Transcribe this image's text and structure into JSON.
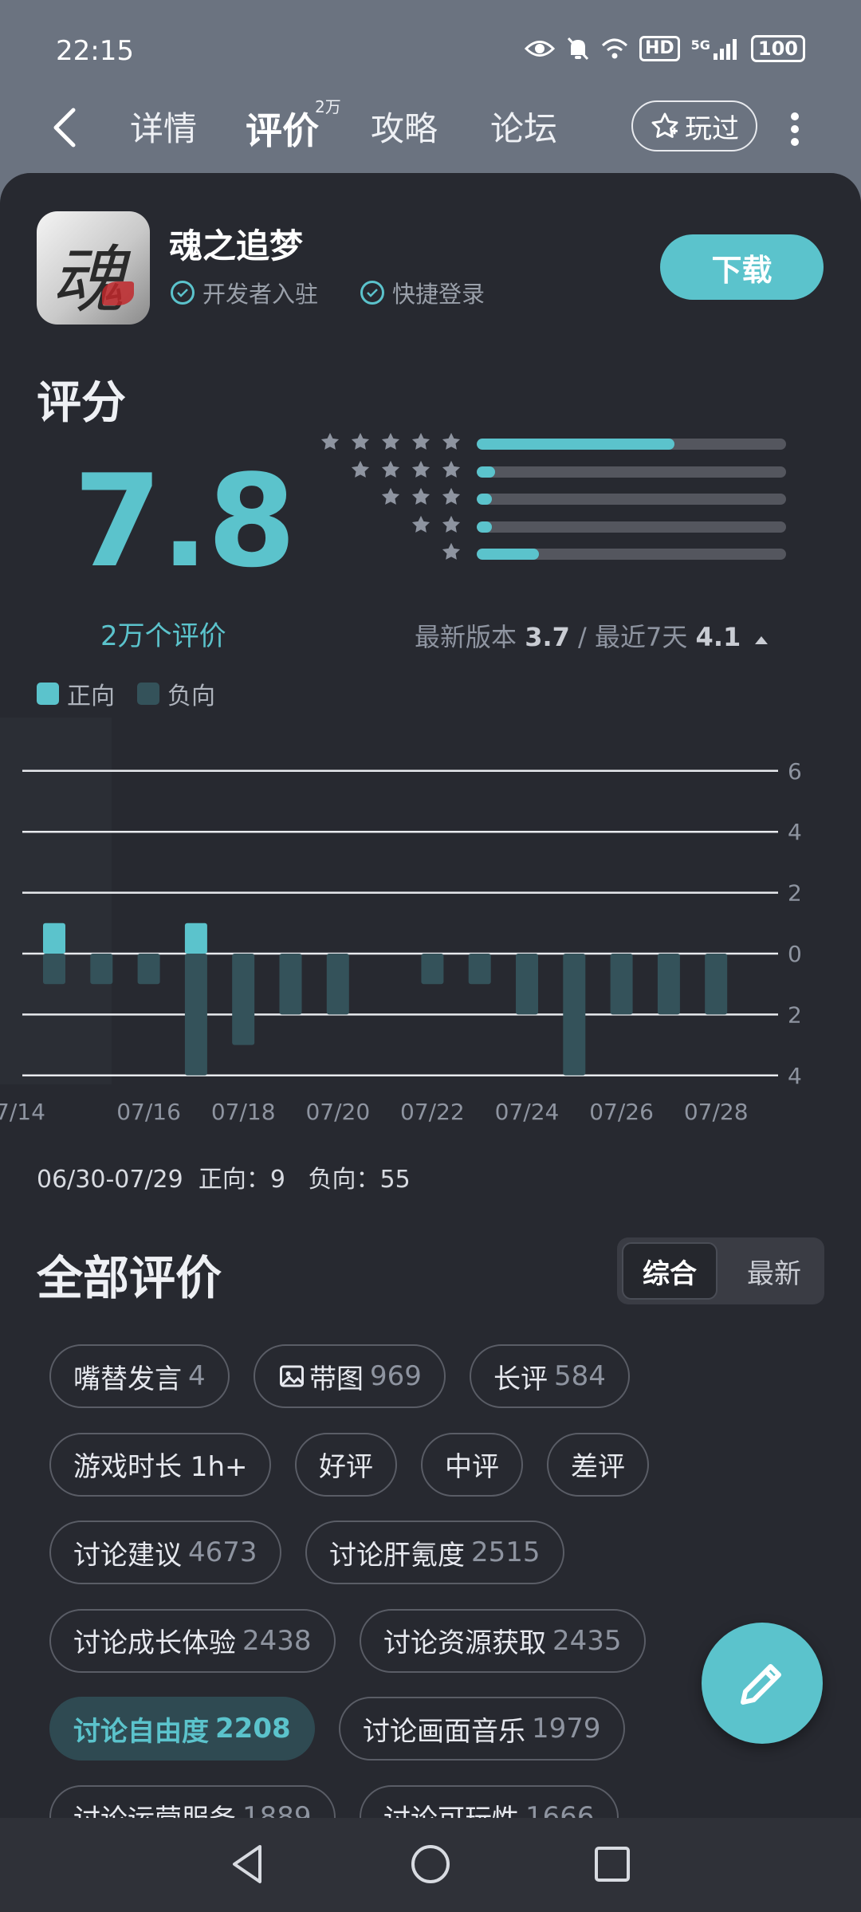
{
  "status": {
    "time": "22:15",
    "hd": "HD",
    "net": "5G",
    "battery": "100"
  },
  "nav": {
    "tabs": [
      "详情",
      "评价",
      "攻略",
      "论坛"
    ],
    "active_tab": "评价",
    "review_sup": "2万",
    "played": "玩过"
  },
  "app": {
    "name": "魂之追梦",
    "icon_char": "魂",
    "tags": [
      "开发者入驻",
      "快捷登录"
    ],
    "download": "下载"
  },
  "rating": {
    "section_title": "评分",
    "score": "7.8",
    "count": "2万个评价",
    "distribution": [
      {
        "stars": 5,
        "fraction": 0.64
      },
      {
        "stars": 4,
        "fraction": 0.06
      },
      {
        "stars": 3,
        "fraction": 0.05
      },
      {
        "stars": 2,
        "fraction": 0.05
      },
      {
        "stars": 1,
        "fraction": 0.2
      }
    ],
    "latest_version_label": "最新版本",
    "latest_version_score": "3.7",
    "recent_label": "最近7天",
    "recent_score": "4.1",
    "trend_icon": "up-triangle-icon"
  },
  "legend": {
    "positive": "正向",
    "negative": "负向"
  },
  "chart_data": {
    "type": "bar",
    "x": [
      "07/14",
      "07/15",
      "07/16",
      "07/17",
      "07/18",
      "07/19",
      "07/20",
      "07/21",
      "07/22",
      "07/23",
      "07/24",
      "07/25",
      "07/26",
      "07/27",
      "07/28",
      "07/29"
    ],
    "tick_labels": [
      "7/14",
      "07/16",
      "07/18",
      "07/20",
      "07/22",
      "07/24",
      "07/26",
      "07/28"
    ],
    "y_ticks": [
      "6",
      "4",
      "2",
      "0",
      "2",
      "4"
    ],
    "ylim": [
      -4,
      6
    ],
    "series": [
      {
        "name": "正向",
        "color": "#5bc3cc",
        "values": [
          1,
          0,
          0,
          1,
          0,
          0,
          0,
          0,
          0,
          0,
          0,
          0,
          0,
          0,
          0,
          0
        ]
      },
      {
        "name": "负向",
        "color": "#34525a",
        "values": [
          -1,
          -1,
          -1,
          -4,
          -3,
          -2,
          -2,
          0,
          -1,
          -1,
          -2,
          -4,
          -2,
          -2,
          -2,
          0
        ]
      }
    ],
    "grid": true
  },
  "summary": {
    "range": "06/30-07/29",
    "positive_label": "正向：9",
    "negative_label": "负向：55"
  },
  "reviews": {
    "title": "全部评价",
    "sort_options": [
      "综合",
      "最新"
    ],
    "sort_active": "综合",
    "chips": [
      {
        "label": "嘴替发言",
        "count": "4"
      },
      {
        "label": "带图",
        "count": "969",
        "icon": "image-icon"
      },
      {
        "label": "长评",
        "count": "584"
      },
      {
        "label": "游戏时长 1h+",
        "count": ""
      },
      {
        "label": "好评",
        "count": ""
      },
      {
        "label": "中评",
        "count": ""
      },
      {
        "label": "差评",
        "count": ""
      },
      {
        "label": "讨论建议",
        "count": "4673"
      },
      {
        "label": "讨论肝氪度",
        "count": "2515"
      },
      {
        "label": "讨论成长体验",
        "count": "2438"
      },
      {
        "label": "讨论资源获取",
        "count": "2435"
      },
      {
        "label": "讨论自由度",
        "count": "2208",
        "selected": true
      },
      {
        "label": "讨论画面音乐",
        "count": "1979"
      },
      {
        "label": "讨论运营服务",
        "count": "1889"
      },
      {
        "label": "讨论可玩性",
        "count": "1666"
      }
    ]
  }
}
